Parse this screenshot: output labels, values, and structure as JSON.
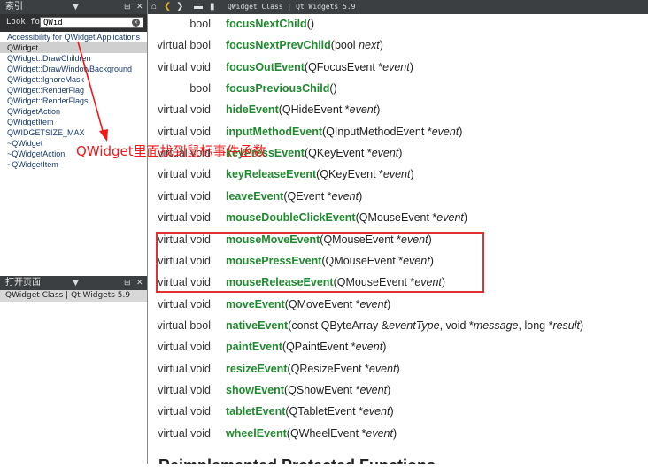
{
  "index_panel": {
    "title": "索引",
    "look_for_label": "Look for:",
    "search_value": "QWid",
    "items": [
      "Accessibility for QWidget Applications",
      "QWidget",
      "QWidget::DrawChildren",
      "QWidget::DrawWindowBackground",
      "QWidget::IgnoreMask",
      "QWidget::RenderFlag",
      "QWidget::RenderFlags",
      "QWidgetAction",
      "QWidgetItem",
      "QWIDGETSIZE_MAX",
      "~QWidget",
      "~QWidgetAction",
      "~QWidgetItem"
    ],
    "selected_index": 1
  },
  "open_pages": {
    "title": "打开页面",
    "items": [
      "QWidget Class | Qt Widgets 5.9"
    ]
  },
  "topbar": {
    "tab_title": "QWidget Class | Qt Widgets 5.9"
  },
  "functions": [
    {
      "ret": "bool",
      "name": "focusNextChild",
      "params": [
        {
          "t": "()"
        }
      ]
    },
    {
      "ret": "virtual bool",
      "name": "focusNextPrevChild",
      "params": [
        {
          "t": "(bool "
        },
        {
          "i": "next"
        },
        {
          "t": ")"
        }
      ]
    },
    {
      "ret": "virtual void",
      "name": "focusOutEvent",
      "params": [
        {
          "t": "(QFocusEvent *"
        },
        {
          "i": "event"
        },
        {
          "t": ")"
        }
      ]
    },
    {
      "ret": "bool",
      "name": "focusPreviousChild",
      "params": [
        {
          "t": "()"
        }
      ]
    },
    {
      "ret": "virtual void",
      "name": "hideEvent",
      "params": [
        {
          "t": "(QHideEvent *"
        },
        {
          "i": "event"
        },
        {
          "t": ")"
        }
      ]
    },
    {
      "ret": "virtual void",
      "name": "inputMethodEvent",
      "params": [
        {
          "t": "(QInputMethodEvent *"
        },
        {
          "i": "event"
        },
        {
          "t": ")"
        }
      ]
    },
    {
      "ret": "virtual void",
      "name": "keyPressEvent",
      "params": [
        {
          "t": "(QKeyEvent *"
        },
        {
          "i": "event"
        },
        {
          "t": ")"
        }
      ]
    },
    {
      "ret": "virtual void",
      "name": "keyReleaseEvent",
      "params": [
        {
          "t": "(QKeyEvent *"
        },
        {
          "i": "event"
        },
        {
          "t": ")"
        }
      ]
    },
    {
      "ret": "virtual void",
      "name": "leaveEvent",
      "params": [
        {
          "t": "(QEvent *"
        },
        {
          "i": "event"
        },
        {
          "t": ")"
        }
      ]
    },
    {
      "ret": "virtual void",
      "name": "mouseDoubleClickEvent",
      "params": [
        {
          "t": "(QMouseEvent *"
        },
        {
          "i": "event"
        },
        {
          "t": ")"
        }
      ]
    },
    {
      "ret": "virtual void",
      "name": "mouseMoveEvent",
      "params": [
        {
          "t": "(QMouseEvent *"
        },
        {
          "i": "event"
        },
        {
          "t": ")"
        }
      ]
    },
    {
      "ret": "virtual void",
      "name": "mousePressEvent",
      "params": [
        {
          "t": "(QMouseEvent *"
        },
        {
          "i": "event"
        },
        {
          "t": ")"
        }
      ]
    },
    {
      "ret": "virtual void",
      "name": "mouseReleaseEvent",
      "params": [
        {
          "t": "(QMouseEvent *"
        },
        {
          "i": "event"
        },
        {
          "t": ")"
        }
      ]
    },
    {
      "ret": "virtual void",
      "name": "moveEvent",
      "params": [
        {
          "t": "(QMoveEvent *"
        },
        {
          "i": "event"
        },
        {
          "t": ")"
        }
      ]
    },
    {
      "ret": "virtual bool",
      "name": "nativeEvent",
      "params": [
        {
          "t": "(const QByteArray &"
        },
        {
          "i": "eventType"
        },
        {
          "t": ", void *"
        },
        {
          "i": "message"
        },
        {
          "t": ", long *"
        },
        {
          "i": "result"
        },
        {
          "t": ")"
        }
      ]
    },
    {
      "ret": "virtual void",
      "name": "paintEvent",
      "params": [
        {
          "t": "(QPaintEvent *"
        },
        {
          "i": "event"
        },
        {
          "t": ")"
        }
      ]
    },
    {
      "ret": "virtual void",
      "name": "resizeEvent",
      "params": [
        {
          "t": "(QResizeEvent *"
        },
        {
          "i": "event"
        },
        {
          "t": ")"
        }
      ]
    },
    {
      "ret": "virtual void",
      "name": "showEvent",
      "params": [
        {
          "t": "(QShowEvent *"
        },
        {
          "i": "event"
        },
        {
          "t": ")"
        }
      ]
    },
    {
      "ret": "virtual void",
      "name": "tabletEvent",
      "params": [
        {
          "t": "(QTabletEvent *"
        },
        {
          "i": "event"
        },
        {
          "t": ")"
        }
      ]
    },
    {
      "ret": "virtual void",
      "name": "wheelEvent",
      "params": [
        {
          "t": "(QWheelEvent *"
        },
        {
          "i": "event"
        },
        {
          "t": ")"
        }
      ]
    }
  ],
  "annotation_text": "QWidget里面找到鼠标事件函数",
  "highlight_color": "#e23030",
  "function_name_color": "#1f8a2e"
}
